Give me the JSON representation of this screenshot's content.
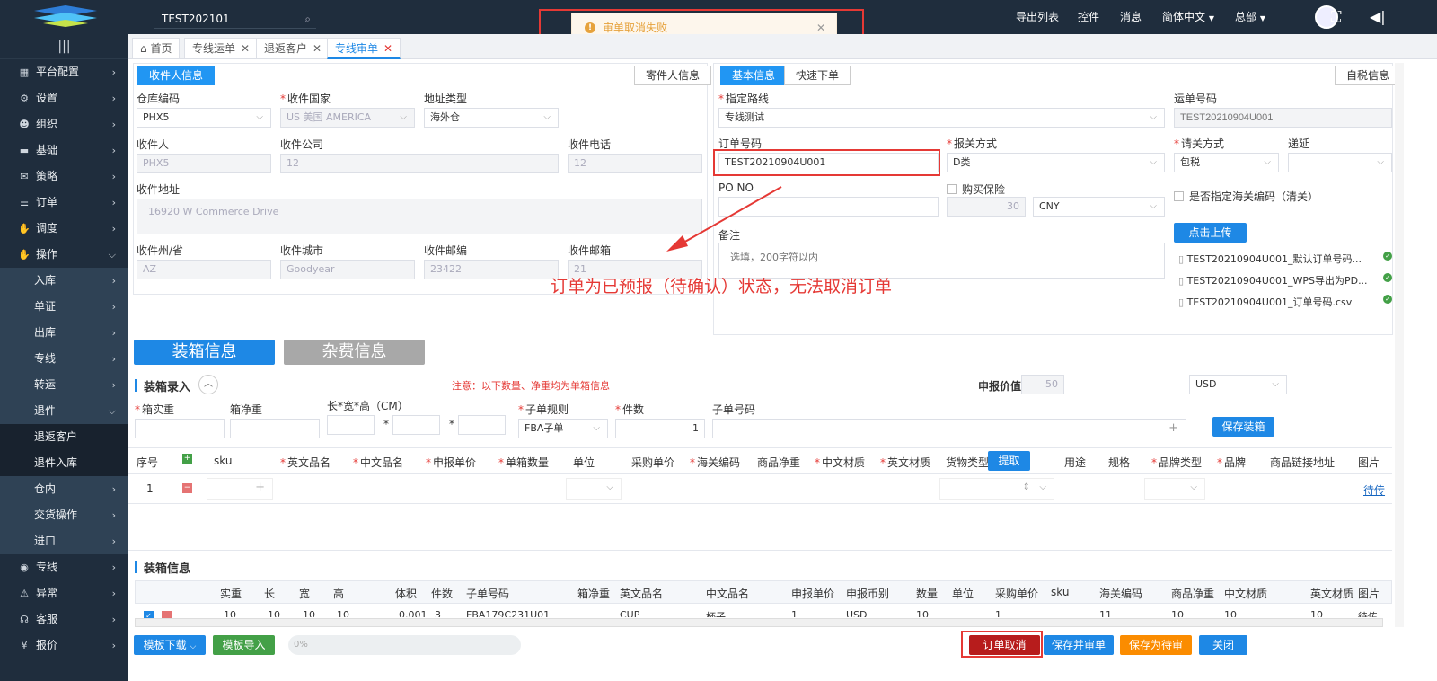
{
  "top": {
    "search_value": "TEST202101",
    "export_list": "导出列表",
    "controls": "控件",
    "messages": "消息",
    "language": "简体中文",
    "hq": "总部"
  },
  "toast": {
    "text": "审单取消失败"
  },
  "sidebar": {
    "items": [
      {
        "label": "平台配置",
        "icon": "grid-icon",
        "arrow": ">"
      },
      {
        "label": "设置",
        "icon": "gear-icon",
        "arrow": ">"
      },
      {
        "label": "组织",
        "icon": "people-icon",
        "arrow": ">"
      },
      {
        "label": "基础",
        "icon": "truck-icon",
        "arrow": ">"
      },
      {
        "label": "策略",
        "icon": "chat-icon",
        "arrow": ">"
      },
      {
        "label": "订单",
        "icon": "list-icon",
        "arrow": ">"
      },
      {
        "label": "调度",
        "icon": "hand-icon",
        "arrow": ">"
      },
      {
        "label": "操作",
        "icon": "hand-icon",
        "arrow": "v"
      },
      {
        "label": "入库",
        "arrow": ">"
      },
      {
        "label": "单证",
        "arrow": ">"
      },
      {
        "label": "出库",
        "arrow": ">"
      },
      {
        "label": "专线",
        "arrow": ">"
      },
      {
        "label": "转运",
        "arrow": ">"
      },
      {
        "label": "退件",
        "arrow": "v"
      },
      {
        "label": "退返客户"
      },
      {
        "label": "退件入库"
      },
      {
        "label": "仓内",
        "arrow": ">"
      },
      {
        "label": "交货操作",
        "arrow": ">"
      },
      {
        "label": "进口",
        "arrow": ">"
      },
      {
        "label": "专线",
        "icon": "globe-icon",
        "arrow": ">"
      },
      {
        "label": "异常",
        "icon": "alert-icon",
        "arrow": ">"
      },
      {
        "label": "客服",
        "icon": "headset-icon",
        "arrow": ">"
      },
      {
        "label": "报价",
        "icon": "money-icon",
        "arrow": ">"
      }
    ]
  },
  "tabs": [
    {
      "label": "首页"
    },
    {
      "label": "专线运单"
    },
    {
      "label": "退返客户"
    },
    {
      "label": "专线审单"
    }
  ],
  "receiver": {
    "tab_active": "收件人信息",
    "tab_other": "寄件人信息",
    "warehouse_label": "仓库编码",
    "warehouse_value": "PHX5",
    "country_label": "收件国家",
    "country_value": "US 美国 AMERICA",
    "addr_type_label": "地址类型",
    "addr_type_value": "海外仓",
    "name_label": "收件人",
    "name_value": "PHX5",
    "company_label": "收件公司",
    "company_value": "12",
    "phone_label": "收件电话",
    "phone_value": "12",
    "address_label": "收件地址",
    "address_value": "16920 W Commerce Drive",
    "state_label": "收件州/省",
    "state_value": "AZ",
    "city_label": "收件城市",
    "city_value": "Goodyear",
    "zip_label": "收件邮编",
    "zip_value": "23422",
    "email_label": "收件邮箱",
    "email_value": "21"
  },
  "basic": {
    "tab_active": "基本信息",
    "tab_other": "快速下单",
    "tab_right": "自税信息",
    "route_label": "指定路线",
    "route_value": "专线测试",
    "waybill_label": "运单号码",
    "waybill_placeholder": "TEST20210904U001",
    "order_label": "订单号码",
    "order_value": "TEST20210904U001",
    "customs_label": "报关方式",
    "customs_value": "D类",
    "clearance_label": "请关方式",
    "clearance_value": "包税",
    "delay_label": "递延",
    "po_label": "PO NO",
    "insurance_label": "购买保险",
    "insurance_value": "30",
    "currency_value": "CNY",
    "hs_label": "是否指定海关编码（清关）",
    "upload_label": "点击上传",
    "remark_label": "备注",
    "remark_placeholder": "选填，200字符以内",
    "files": [
      "TEST20210904U001_默认订单号码...",
      "TEST20210904U001_WPS导出为PD...",
      "TEST20210904U001_订单号码.csv"
    ]
  },
  "annotation": "订单为已预报（待确认）状态，无法取消订单",
  "sections": {
    "packing": "装箱信息",
    "misc": "杂费信息"
  },
  "packing_entry": {
    "title": "装箱录入",
    "note": "注意：以下数量、净重均为单箱信息",
    "declared_label": "申报价值",
    "declared_value": "50",
    "declared_currency": "USD",
    "weight_label": "箱实重",
    "net_label": "箱净重",
    "dims_label": "长*宽*高（CM）",
    "rule_label": "子单规则",
    "rule_value": "FBA子单",
    "count_label": "件数",
    "count_value": "1",
    "sub_label": "子单号码",
    "save_label": "保存装箱"
  },
  "sku_table": {
    "headers": [
      "序号",
      "sku",
      "英文品名",
      "中文品名",
      "申报单价",
      "单箱数量",
      "单位",
      "采购单价",
      "海关编码",
      "商品净重",
      "中文材质",
      "英文材质",
      "货物类型",
      "用途",
      "规格",
      "品牌类型",
      "品牌",
      "商品链接地址",
      "图片"
    ],
    "extract_label": "提取",
    "row": {
      "index": "1",
      "image_link": "待传"
    }
  },
  "packing_info": {
    "title": "装箱信息",
    "headers": [
      "实重",
      "长",
      "宽",
      "高",
      "体积",
      "件数",
      "子单号码",
      "箱净重",
      "英文品名",
      "中文品名",
      "申报单价",
      "申报币别",
      "数量",
      "单位",
      "采购单价",
      "sku",
      "海关编码",
      "商品净重",
      "中文材质",
      "英文材质",
      "图片"
    ],
    "row": [
      "10",
      "10",
      "10",
      "10",
      "0.001",
      "3",
      "FBA179C231U01",
      "",
      "CUP",
      "杯子",
      "1",
      "USD",
      "10",
      "",
      "1",
      "",
      "11",
      "10",
      "10",
      "10",
      "待传"
    ]
  },
  "footer": {
    "template_download": "模板下载",
    "template_import": "模板导入",
    "progress": "0%",
    "cancel": "订单取消",
    "save_review": "保存并审单",
    "save_pending": "保存为待审",
    "close": "关闭"
  },
  "colors": {
    "sidebar": "#1f2d3d",
    "primary": "#2196f3",
    "danger": "#b71c1c",
    "success": "#43a047",
    "warning": "#fb8c00"
  }
}
